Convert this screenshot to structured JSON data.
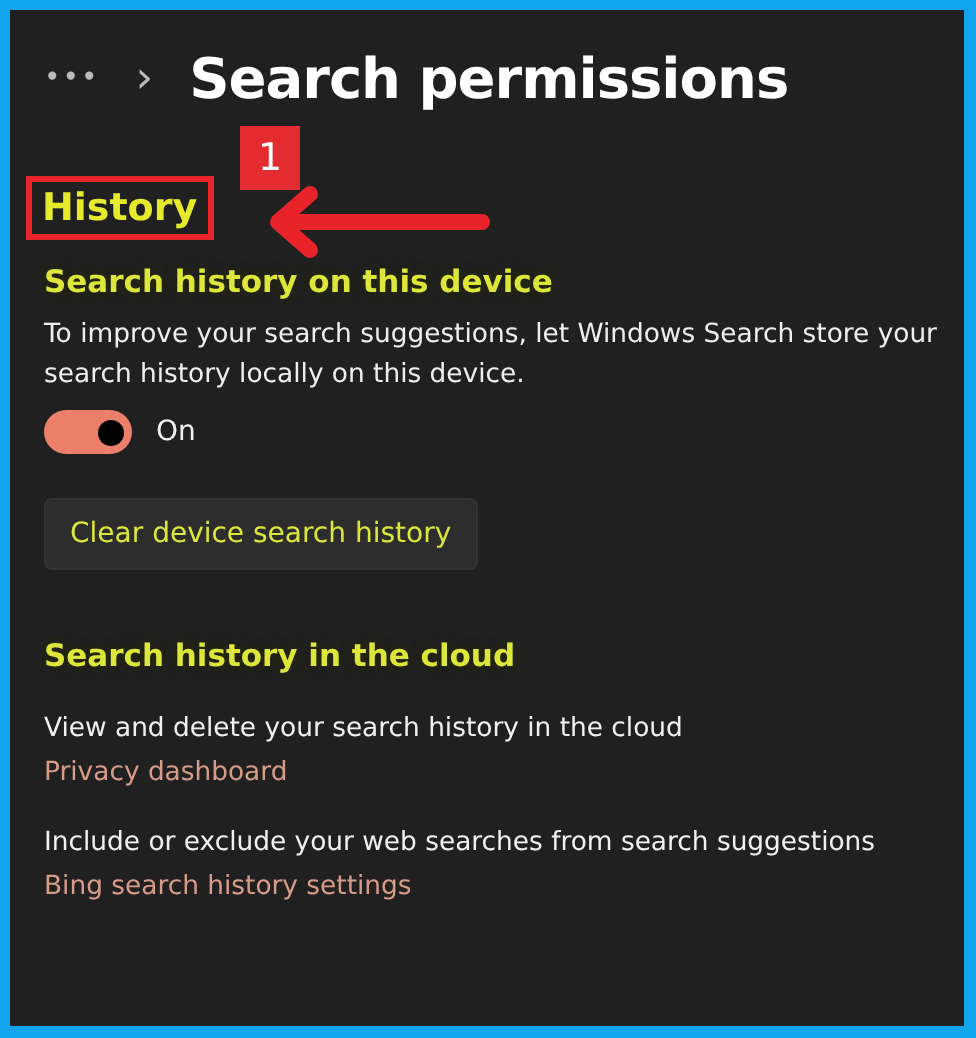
{
  "breadcrumb": {
    "more": "•••",
    "separator": "›",
    "title": "Search permissions"
  },
  "annotation": {
    "badge": "1"
  },
  "section": {
    "heading": "History"
  },
  "device": {
    "heading": "Search history on this device",
    "description_lines": [
      "To improve your search suggestions, let Windows Search store your",
      "search history locally on this device."
    ],
    "toggle": {
      "on": true,
      "label": "On"
    },
    "button": "Clear device search history"
  },
  "cloud": {
    "heading": "Search history in the cloud",
    "items": [
      {
        "text": "View and delete your search history in the cloud",
        "link": "Privacy dashboard"
      },
      {
        "text": "Include or exclude your web searches from search suggestions",
        "link": "Bing search history settings"
      }
    ]
  }
}
